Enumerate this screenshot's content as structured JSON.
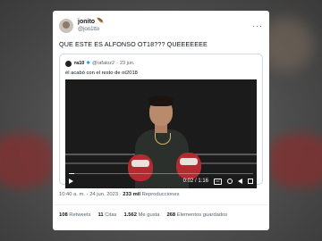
{
  "tweet": {
    "display_name": "jonito 🪶",
    "handle": "@jon1tto",
    "more_label": "···",
    "text": "QUE ESTE ES ALFONSO OT18??? QUEEEEEEE",
    "quote": {
      "display_name": "ra10",
      "verified_mark": "✱",
      "handle": "@rafaloz2",
      "dot": "·",
      "date": "23 jun.",
      "text": "él acabó con el resto de ot2018",
      "video": {
        "time": "0:02 / 1:16",
        "progress_fraction": 0.03
      }
    },
    "time": "10:40 a. m.",
    "date": "24 jun. 2023",
    "views_count": "233 mil",
    "views_label": "Reproducciones",
    "stats": [
      {
        "count": "108",
        "label": "Retweets"
      },
      {
        "count": "11",
        "label": "Citas"
      },
      {
        "count": "1.562",
        "label": "Me gusta"
      },
      {
        "count": "268",
        "label": "Elementos guardados"
      }
    ]
  },
  "colors": {
    "accent": "#1d9bf0",
    "glove": "#b32a30"
  }
}
